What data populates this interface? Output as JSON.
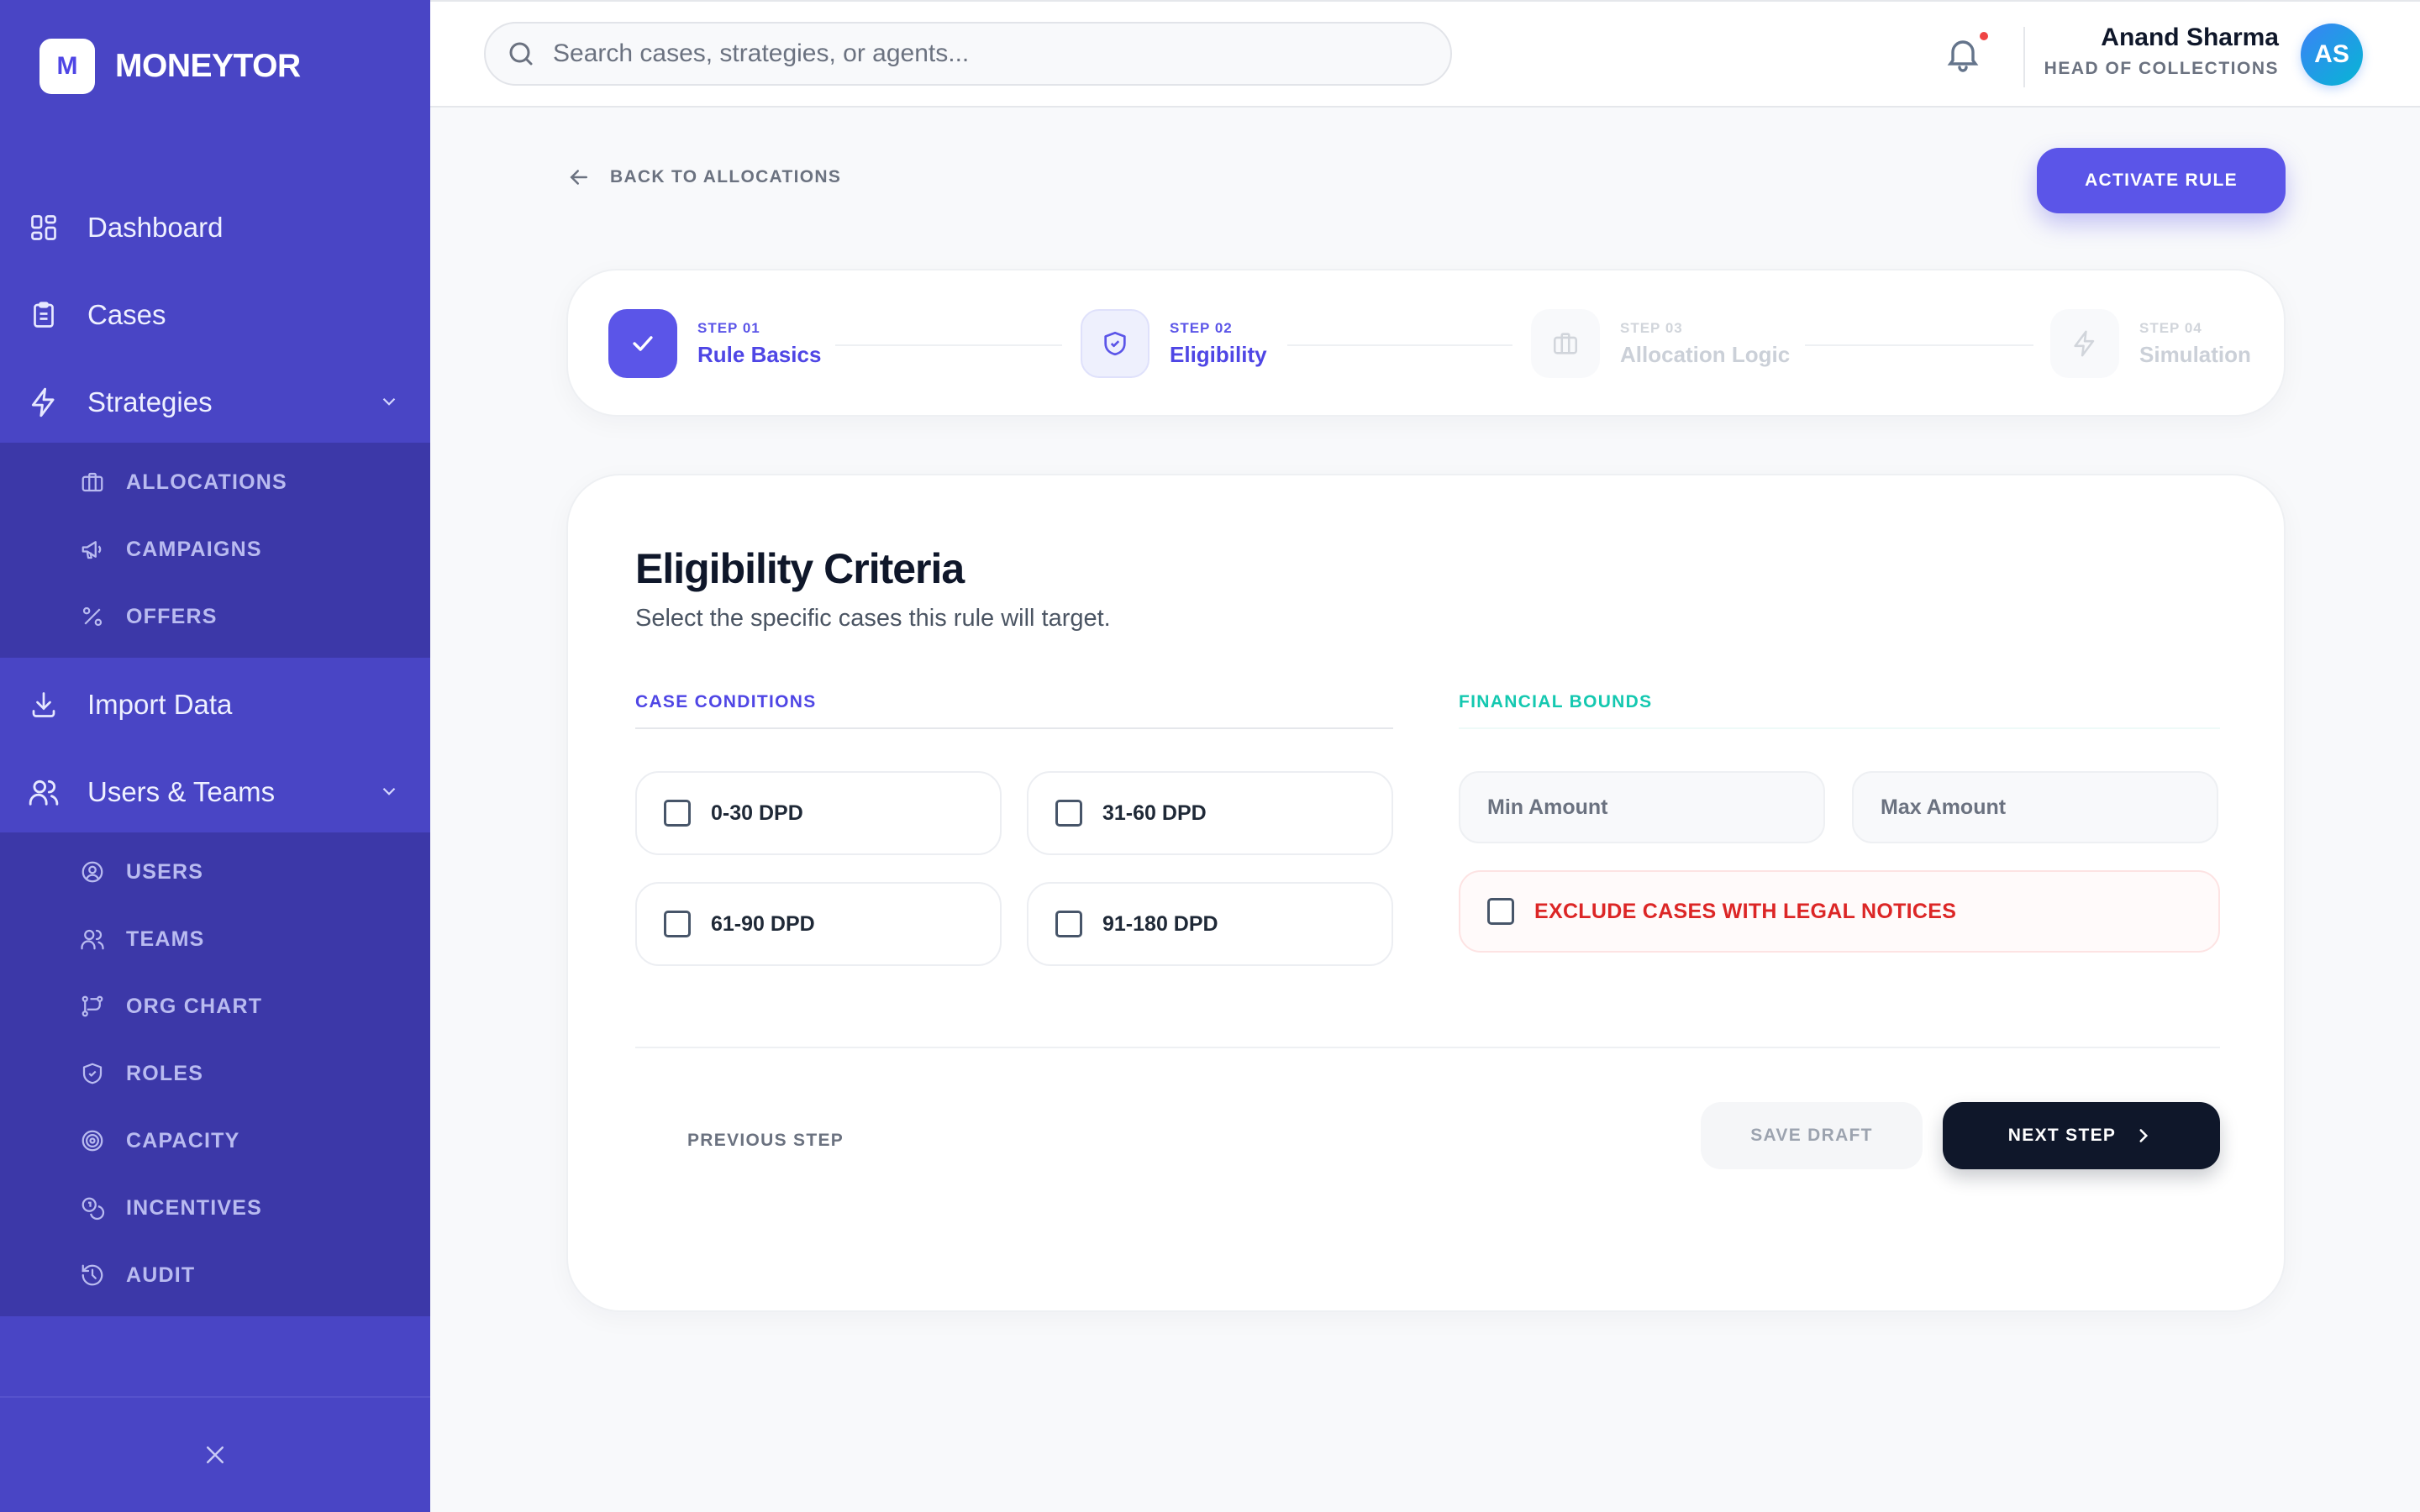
{
  "brand": {
    "logo_letter": "M",
    "name": "MONEYTOR"
  },
  "sidebar": {
    "items": [
      {
        "label": "Dashboard",
        "icon": "dashboard-grid-icon"
      },
      {
        "label": "Cases",
        "icon": "clipboard-icon"
      },
      {
        "label": "Strategies",
        "icon": "lightning-icon",
        "expanded": true
      },
      {
        "label": "Import Data",
        "icon": "download-icon"
      },
      {
        "label": "Users & Teams",
        "icon": "users-icon",
        "expanded": true
      }
    ],
    "strategies_sub": [
      {
        "label": "ALLOCATIONS",
        "icon": "briefcase-icon"
      },
      {
        "label": "CAMPAIGNS",
        "icon": "megaphone-icon"
      },
      {
        "label": "OFFERS",
        "icon": "percent-icon"
      }
    ],
    "users_sub": [
      {
        "label": "USERS",
        "icon": "user-circle-icon"
      },
      {
        "label": "TEAMS",
        "icon": "team-icon"
      },
      {
        "label": "ORG CHART",
        "icon": "org-chart-icon"
      },
      {
        "label": "ROLES",
        "icon": "shield-icon"
      },
      {
        "label": "CAPACITY",
        "icon": "target-icon"
      },
      {
        "label": "INCENTIVES",
        "icon": "coins-icon"
      },
      {
        "label": "AUDIT",
        "icon": "history-icon"
      }
    ]
  },
  "header": {
    "search_placeholder": "Search cases, strategies, or agents...",
    "user_name": "Anand Sharma",
    "user_role": "HEAD OF COLLECTIONS",
    "avatar_initials": "AS"
  },
  "main": {
    "back_label": "BACK TO ALLOCATIONS",
    "activate_label": "ACTIVATE RULE",
    "steps": [
      {
        "num": "STEP 01",
        "name": "Rule Basics",
        "state": "complete"
      },
      {
        "num": "STEP 02",
        "name": "Eligibility",
        "state": "active"
      },
      {
        "num": "STEP 03",
        "name": "Allocation Logic",
        "state": "upcoming"
      },
      {
        "num": "STEP 04",
        "name": "Simulation",
        "state": "upcoming"
      }
    ],
    "card": {
      "title": "Eligibility Criteria",
      "subtitle": "Select the specific cases this rule will target.",
      "case_conditions_title": "CASE CONDITIONS",
      "case_options": [
        "0-30 DPD",
        "31-60 DPD",
        "61-90 DPD",
        "91-180 DPD"
      ],
      "financial_bounds_title": "FINANCIAL BOUNDS",
      "min_placeholder": "Min Amount",
      "max_placeholder": "Max Amount",
      "legal_label": "EXCLUDE CASES WITH LEGAL NOTICES",
      "prev_label": "PREVIOUS STEP",
      "save_label": "SAVE DRAFT",
      "next_label": "NEXT STEP"
    }
  },
  "colors": {
    "sidebar": "#4945c5",
    "sidebar_sub": "#3c38a8",
    "accent": "#5b55e8",
    "teal": "#14b8a6",
    "danger": "#dc2626",
    "dark": "#0f172a"
  }
}
